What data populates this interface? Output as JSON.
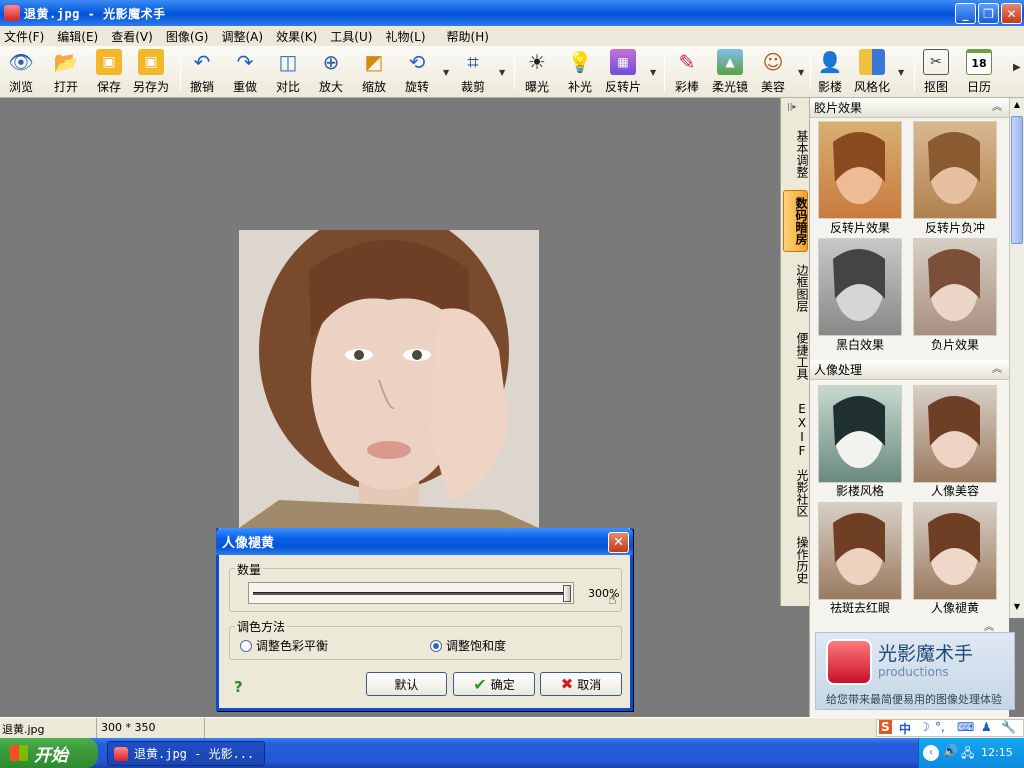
{
  "window": {
    "title": "退黄.jpg - 光影魔术手"
  },
  "menu": [
    "文件(F)",
    "编辑(E)",
    "查看(V)",
    "图像(G)",
    "调整(A)",
    "效果(K)",
    "工具(U)",
    "礼物(L)",
    "帮助(H)"
  ],
  "toolbar": {
    "browse": "浏览",
    "open": "打开",
    "save": "保存",
    "save_as": "另存为",
    "undo": "撤销",
    "redo": "重做",
    "compare": "对比",
    "zoom_in": "放大",
    "scale": "缩放",
    "rotate": "旋转",
    "crop": "裁剪",
    "exposure": "曝光",
    "fill_light": "补光",
    "inverse": "反转片",
    "color_pencil": "彩棒",
    "soft_mirror": "柔光镜",
    "beauty": "美容",
    "studio": "影楼",
    "stylize": "风格化",
    "cutout": "抠图",
    "calendar": "日历",
    "calendar_num": "18"
  },
  "side_tabs": [
    "基本调整",
    "数码暗房",
    "边框图层",
    "便捷工具",
    "EXIF",
    "光影社区",
    "操作历史"
  ],
  "panel": {
    "section1_title": "胶片效果",
    "section2_title": "人像处理",
    "items": [
      "反转片效果",
      "反转片负冲",
      "黑白效果",
      "负片效果",
      "影楼风格",
      "人像美容",
      "祛斑去红眼",
      "人像褪黄"
    ]
  },
  "logo": {
    "title": "光影魔术手",
    "sub": "productions",
    "slogan": "给您带来最简便易用的图像处理体验"
  },
  "status": {
    "filename": "退黄.jpg",
    "dimensions": "300 * 350"
  },
  "dialog": {
    "title": "人像褪黄",
    "amount_label": "数量",
    "amount_value": "300%",
    "amount_fraction": 1.0,
    "method_label": "调色方法",
    "option1": "调整色彩平衡",
    "option2": "调整饱和度",
    "selected": "调整饱和度",
    "help": "?",
    "btn_default": "默认",
    "btn_ok": "确定",
    "btn_cancel": "取消"
  },
  "taskbar": {
    "start": "开始",
    "task": "退黄.jpg - 光影...",
    "time": "12:15",
    "ime": "中"
  },
  "colors": {
    "accent": "#0a5ee0",
    "workspace": "#7a7a7a",
    "active_tab": "#f3a32a"
  }
}
